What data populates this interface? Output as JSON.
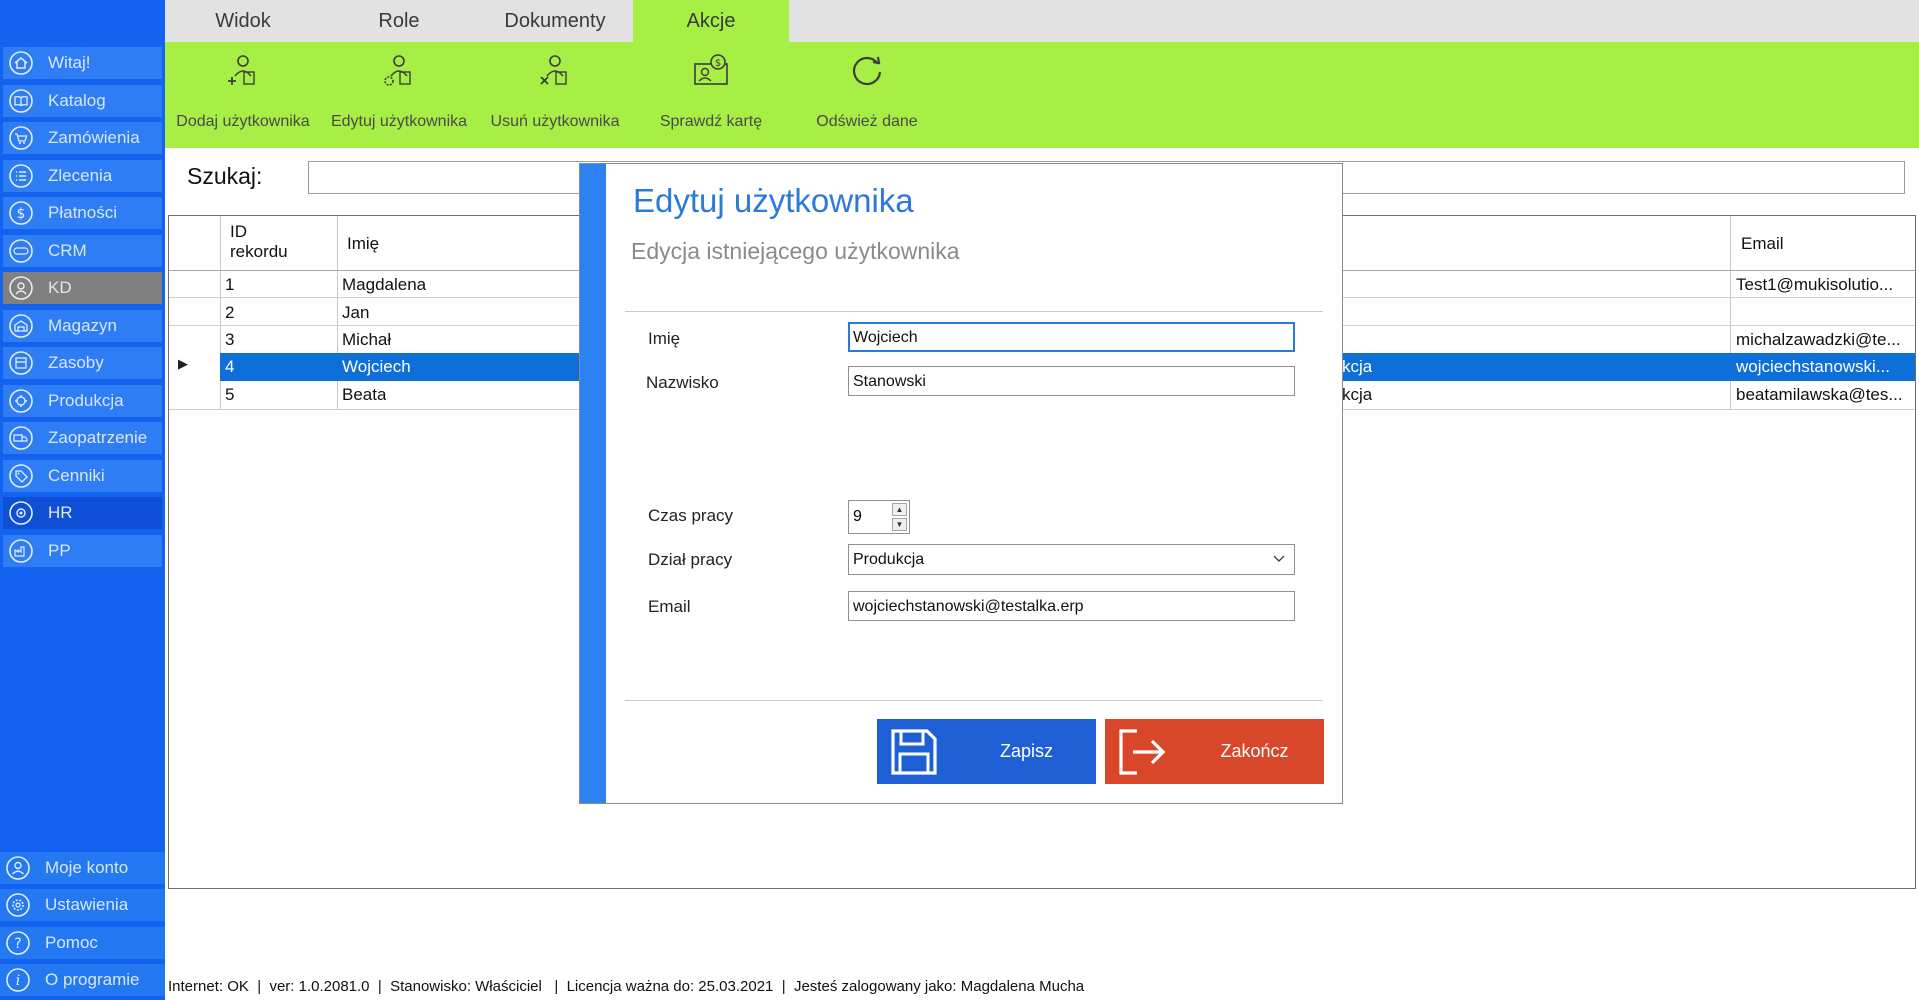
{
  "sidebar": {
    "items": [
      {
        "label": "Witaj!",
        "icon": "home-icon"
      },
      {
        "label": "Katalog",
        "icon": "book-icon"
      },
      {
        "label": "Zamówienia",
        "icon": "cart-icon"
      },
      {
        "label": "Zlecenia",
        "icon": "list-icon"
      },
      {
        "label": "Płatności",
        "icon": "dollar-icon"
      },
      {
        "label": "CRM",
        "icon": "crm-icon"
      },
      {
        "label": "KD",
        "icon": "user-lock-icon"
      },
      {
        "label": "Magazyn",
        "icon": "warehouse-icon"
      },
      {
        "label": "Zasoby",
        "icon": "resources-icon"
      },
      {
        "label": "Produkcja",
        "icon": "production-icon"
      },
      {
        "label": "Zaopatrzenie",
        "icon": "truck-icon"
      },
      {
        "label": "Cenniki",
        "icon": "tag-icon"
      },
      {
        "label": "HR",
        "icon": "hr-icon"
      },
      {
        "label": "PP",
        "icon": "pp-icon"
      }
    ],
    "bottom_items": [
      {
        "label": "Moje konto",
        "icon": "account-icon"
      },
      {
        "label": "Ustawienia",
        "icon": "settings-icon"
      },
      {
        "label": "Pomoc",
        "icon": "help-icon"
      },
      {
        "label": "O programie",
        "icon": "info-icon"
      }
    ],
    "active": "KD",
    "selected": "HR"
  },
  "tabs": [
    "Widok",
    "Role",
    "Dokumenty",
    "Akcje"
  ],
  "active_tab": "Akcje",
  "ribbon": {
    "buttons": [
      {
        "label": "Dodaj użytkownika",
        "icon": "add-user-icon"
      },
      {
        "label": "Edytuj użytkownika",
        "icon": "edit-user-icon"
      },
      {
        "label": "Usuń użytkownika",
        "icon": "delete-user-icon"
      },
      {
        "label": "Sprawdź kartę",
        "icon": "check-card-icon"
      },
      {
        "label": "Odśwież dane",
        "icon": "refresh-icon"
      }
    ]
  },
  "search": {
    "label": "Szukaj:",
    "value": ""
  },
  "grid": {
    "headers": {
      "id": "ID\nrekordu",
      "first_name": "Imię",
      "email": "Email"
    },
    "rows": [
      {
        "id": "1",
        "first_name": "Magdalena",
        "dept": "",
        "email": "Test1@mukisolutio..."
      },
      {
        "id": "2",
        "first_name": "Jan",
        "dept": "",
        "email": ""
      },
      {
        "id": "3",
        "first_name": "Michał",
        "dept": "",
        "email": "michalzawadzki@te..."
      },
      {
        "id": "4",
        "first_name": "Wojciech",
        "dept": "kcja",
        "email": "wojciechstanowski..."
      },
      {
        "id": "5",
        "first_name": "Beata",
        "dept": "kcja",
        "email": "beatamilawska@tes..."
      }
    ],
    "selected_row": 3
  },
  "modal": {
    "title": "Edytuj użytkownika",
    "subtitle": "Edycja istniejącego użytkownika",
    "fields": {
      "first_name": {
        "label": "Imię",
        "value": "Wojciech"
      },
      "last_name": {
        "label": "Nazwisko",
        "value": "Stanowski"
      },
      "work_hours": {
        "label": "Czas pracy",
        "value": "9"
      },
      "department": {
        "label": "Dział pracy",
        "value": "Produkcja"
      },
      "email": {
        "label": "Email",
        "value": "wojciechstanowski@testalka.erp"
      }
    },
    "save_label": "Zapisz",
    "close_label": "Zakończ",
    "save_color": "#1f5fd6",
    "close_color": "#d9472b"
  },
  "status_bar": {
    "internet": "Internet: OK",
    "version": "ver: 1.0.2081.0",
    "station": "Stanowisko: Właściciel",
    "license": "Licencja ważna do: 25.03.2021",
    "logged_in": "Jesteś zalogowany jako: Magdalena Mucha"
  },
  "colors": {
    "sidebar": "#1463f0",
    "ribbon": "#a7ee45",
    "accent": "#2b7ad8",
    "selection": "#0d6fd7"
  }
}
